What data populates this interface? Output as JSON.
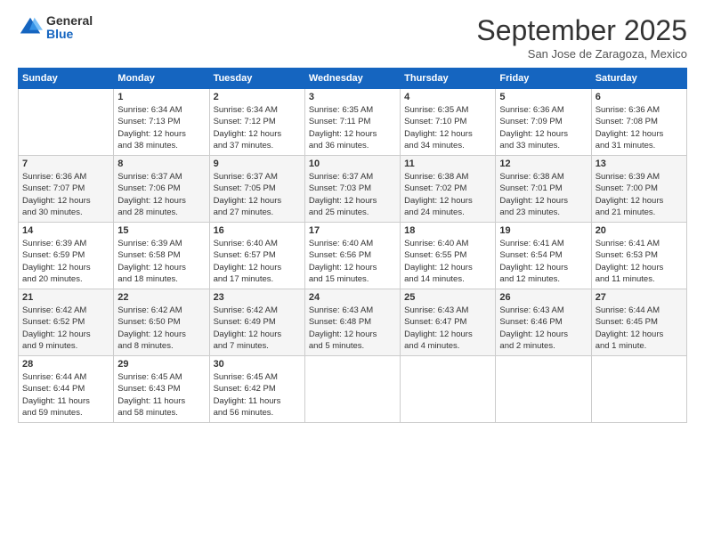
{
  "logo": {
    "general": "General",
    "blue": "Blue"
  },
  "title": "September 2025",
  "subtitle": "San Jose de Zaragoza, Mexico",
  "days_of_week": [
    "Sunday",
    "Monday",
    "Tuesday",
    "Wednesday",
    "Thursday",
    "Friday",
    "Saturday"
  ],
  "weeks": [
    [
      {
        "day": "",
        "info": ""
      },
      {
        "day": "1",
        "info": "Sunrise: 6:34 AM\nSunset: 7:13 PM\nDaylight: 12 hours\nand 38 minutes."
      },
      {
        "day": "2",
        "info": "Sunrise: 6:34 AM\nSunset: 7:12 PM\nDaylight: 12 hours\nand 37 minutes."
      },
      {
        "day": "3",
        "info": "Sunrise: 6:35 AM\nSunset: 7:11 PM\nDaylight: 12 hours\nand 36 minutes."
      },
      {
        "day": "4",
        "info": "Sunrise: 6:35 AM\nSunset: 7:10 PM\nDaylight: 12 hours\nand 34 minutes."
      },
      {
        "day": "5",
        "info": "Sunrise: 6:36 AM\nSunset: 7:09 PM\nDaylight: 12 hours\nand 33 minutes."
      },
      {
        "day": "6",
        "info": "Sunrise: 6:36 AM\nSunset: 7:08 PM\nDaylight: 12 hours\nand 31 minutes."
      }
    ],
    [
      {
        "day": "7",
        "info": "Sunrise: 6:36 AM\nSunset: 7:07 PM\nDaylight: 12 hours\nand 30 minutes."
      },
      {
        "day": "8",
        "info": "Sunrise: 6:37 AM\nSunset: 7:06 PM\nDaylight: 12 hours\nand 28 minutes."
      },
      {
        "day": "9",
        "info": "Sunrise: 6:37 AM\nSunset: 7:05 PM\nDaylight: 12 hours\nand 27 minutes."
      },
      {
        "day": "10",
        "info": "Sunrise: 6:37 AM\nSunset: 7:03 PM\nDaylight: 12 hours\nand 25 minutes."
      },
      {
        "day": "11",
        "info": "Sunrise: 6:38 AM\nSunset: 7:02 PM\nDaylight: 12 hours\nand 24 minutes."
      },
      {
        "day": "12",
        "info": "Sunrise: 6:38 AM\nSunset: 7:01 PM\nDaylight: 12 hours\nand 23 minutes."
      },
      {
        "day": "13",
        "info": "Sunrise: 6:39 AM\nSunset: 7:00 PM\nDaylight: 12 hours\nand 21 minutes."
      }
    ],
    [
      {
        "day": "14",
        "info": "Sunrise: 6:39 AM\nSunset: 6:59 PM\nDaylight: 12 hours\nand 20 minutes."
      },
      {
        "day": "15",
        "info": "Sunrise: 6:39 AM\nSunset: 6:58 PM\nDaylight: 12 hours\nand 18 minutes."
      },
      {
        "day": "16",
        "info": "Sunrise: 6:40 AM\nSunset: 6:57 PM\nDaylight: 12 hours\nand 17 minutes."
      },
      {
        "day": "17",
        "info": "Sunrise: 6:40 AM\nSunset: 6:56 PM\nDaylight: 12 hours\nand 15 minutes."
      },
      {
        "day": "18",
        "info": "Sunrise: 6:40 AM\nSunset: 6:55 PM\nDaylight: 12 hours\nand 14 minutes."
      },
      {
        "day": "19",
        "info": "Sunrise: 6:41 AM\nSunset: 6:54 PM\nDaylight: 12 hours\nand 12 minutes."
      },
      {
        "day": "20",
        "info": "Sunrise: 6:41 AM\nSunset: 6:53 PM\nDaylight: 12 hours\nand 11 minutes."
      }
    ],
    [
      {
        "day": "21",
        "info": "Sunrise: 6:42 AM\nSunset: 6:52 PM\nDaylight: 12 hours\nand 9 minutes."
      },
      {
        "day": "22",
        "info": "Sunrise: 6:42 AM\nSunset: 6:50 PM\nDaylight: 12 hours\nand 8 minutes."
      },
      {
        "day": "23",
        "info": "Sunrise: 6:42 AM\nSunset: 6:49 PM\nDaylight: 12 hours\nand 7 minutes."
      },
      {
        "day": "24",
        "info": "Sunrise: 6:43 AM\nSunset: 6:48 PM\nDaylight: 12 hours\nand 5 minutes."
      },
      {
        "day": "25",
        "info": "Sunrise: 6:43 AM\nSunset: 6:47 PM\nDaylight: 12 hours\nand 4 minutes."
      },
      {
        "day": "26",
        "info": "Sunrise: 6:43 AM\nSunset: 6:46 PM\nDaylight: 12 hours\nand 2 minutes."
      },
      {
        "day": "27",
        "info": "Sunrise: 6:44 AM\nSunset: 6:45 PM\nDaylight: 12 hours\nand 1 minute."
      }
    ],
    [
      {
        "day": "28",
        "info": "Sunrise: 6:44 AM\nSunset: 6:44 PM\nDaylight: 11 hours\nand 59 minutes."
      },
      {
        "day": "29",
        "info": "Sunrise: 6:45 AM\nSunset: 6:43 PM\nDaylight: 11 hours\nand 58 minutes."
      },
      {
        "day": "30",
        "info": "Sunrise: 6:45 AM\nSunset: 6:42 PM\nDaylight: 11 hours\nand 56 minutes."
      },
      {
        "day": "",
        "info": ""
      },
      {
        "day": "",
        "info": ""
      },
      {
        "day": "",
        "info": ""
      },
      {
        "day": "",
        "info": ""
      }
    ]
  ]
}
